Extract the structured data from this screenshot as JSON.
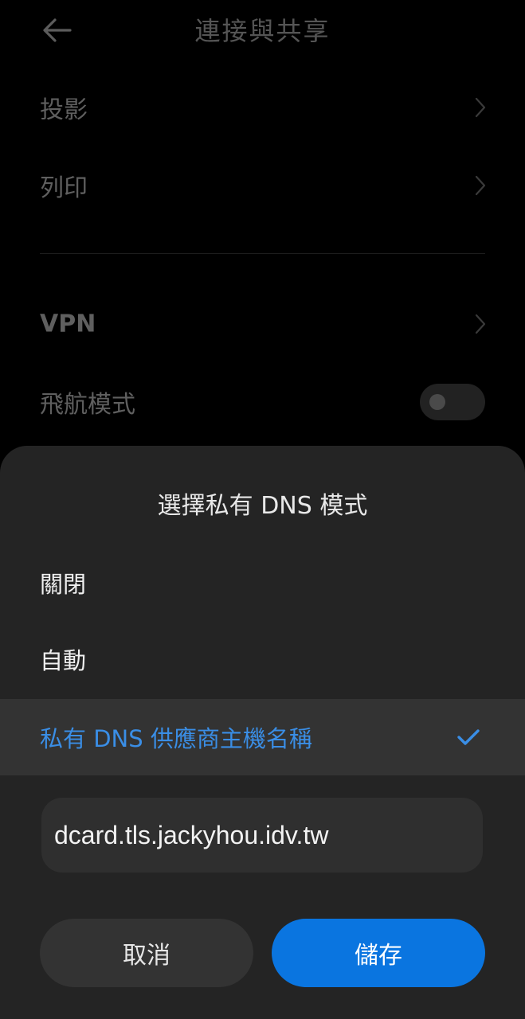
{
  "header": {
    "title": "連接與共享"
  },
  "settings": {
    "items": [
      {
        "label": "投影"
      },
      {
        "label": "列印"
      },
      {
        "label": "VPN"
      },
      {
        "label": "飛航模式",
        "toggle_on": false
      }
    ]
  },
  "dialog": {
    "title": "選擇私有 DNS 模式",
    "options": [
      {
        "label": "關閉",
        "selected": false
      },
      {
        "label": "自動",
        "selected": false
      },
      {
        "label": "私有 DNS 供應商主機名稱",
        "selected": true
      }
    ],
    "hostname_value": "dcard.tls.jackyhou.idv.tw",
    "cancel_label": "取消",
    "save_label": "儲存"
  },
  "colors": {
    "accent": "#0a75e0",
    "selected_text": "#3a8ee6",
    "sheet_bg": "#242424"
  }
}
